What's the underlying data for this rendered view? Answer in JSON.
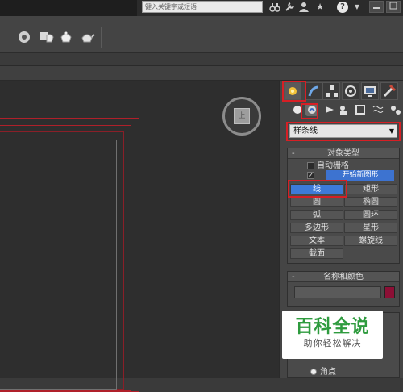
{
  "titlebar": {
    "search_placeholder": "键入关键字或短语",
    "help_label": "?"
  },
  "command_panel": {
    "tabs": [
      "create",
      "modify",
      "hierarchy",
      "motion",
      "display",
      "utilities"
    ],
    "subtabs": [
      "geometry",
      "shapes",
      "lights",
      "cameras",
      "helpers",
      "space-warps",
      "systems"
    ],
    "category_dropdown": "样条线",
    "object_type": {
      "header": "对象类型",
      "autogrid_label": "自动栅格",
      "start_new_shape_label": "开始新图形",
      "start_new_shape_checked": true,
      "buttons": [
        "线",
        "矩形",
        "圆",
        "椭圆",
        "弧",
        "圆环",
        "多边形",
        "星形",
        "文本",
        "螺旋线",
        "截面"
      ],
      "active_button": "线"
    },
    "name_color": {
      "header": "名称和颜色",
      "swatch_color": "#8c0f35"
    },
    "creation_method": {
      "option": "角点"
    }
  },
  "watermark": {
    "title": "百科全说",
    "subtitle": "助你轻松解决"
  },
  "colors": {
    "highlight": "#d71f25",
    "active_button": "#3d7ad8",
    "viewport_frame": "#b0202a"
  }
}
